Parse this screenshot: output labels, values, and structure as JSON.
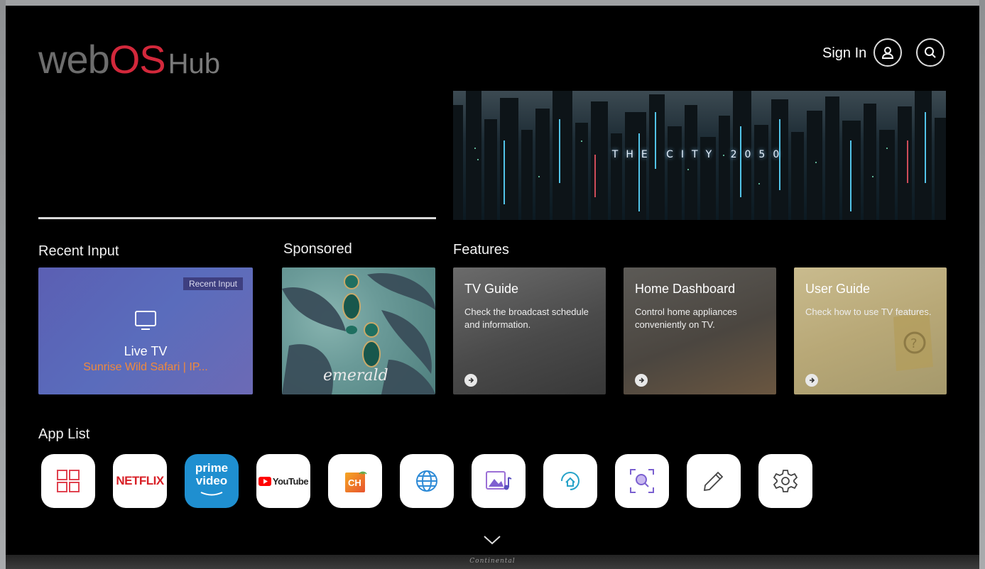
{
  "logo": {
    "web": "web",
    "os": "OS",
    "hub": "Hub"
  },
  "header": {
    "sign_in": "Sign In",
    "user_icon": "user-icon",
    "search_icon": "search-icon"
  },
  "hero": {
    "banner_text": "THE CITY 2050"
  },
  "sections": {
    "recent_input": "Recent Input",
    "sponsored": "Sponsored",
    "features": "Features",
    "app_list": "App List"
  },
  "recent_card": {
    "badge": "Recent Input",
    "icon": "tv-icon",
    "title": "Live TV",
    "subtitle": "Sunrise Wild Safari | IP..."
  },
  "sponsored_card": {
    "text": "emerald"
  },
  "features": [
    {
      "title": "TV Guide",
      "desc": "Check the broadcast schedule and information."
    },
    {
      "title": "Home Dashboard",
      "desc": "Control home appliances conveniently on TV."
    },
    {
      "title": "User Guide",
      "desc": "Check how to use TV features."
    }
  ],
  "apps": [
    {
      "name": "all-apps",
      "icon": "grid-icon"
    },
    {
      "name": "netflix",
      "label": "NETFLIX"
    },
    {
      "name": "prime-video",
      "label_top": "prime",
      "label_bottom": "video"
    },
    {
      "name": "youtube",
      "label": "YouTube"
    },
    {
      "name": "channels",
      "label": "CH"
    },
    {
      "name": "web-browser",
      "icon": "globe-icon"
    },
    {
      "name": "media-player",
      "icon": "music-photo-icon"
    },
    {
      "name": "home-hub",
      "icon": "home-icon"
    },
    {
      "name": "screen-search",
      "icon": "scan-search-icon"
    },
    {
      "name": "edit",
      "icon": "pencil-icon"
    },
    {
      "name": "settings",
      "icon": "gear-icon"
    }
  ],
  "footer": {
    "brand": "Continental"
  },
  "colors": {
    "accent": "#d3283b",
    "recent_subtitle": "#f08a3c",
    "prime": "#1f8fd0",
    "netflix": "#d81f26"
  }
}
